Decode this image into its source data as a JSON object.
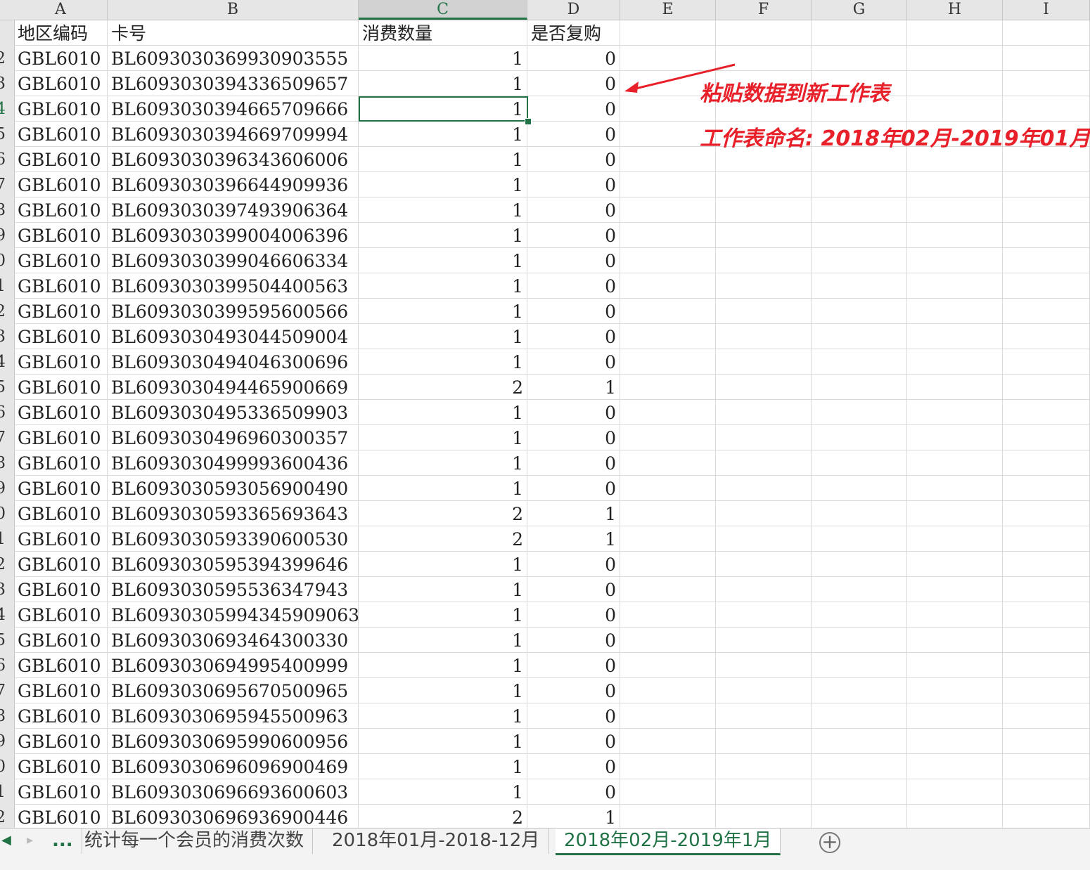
{
  "columns": [
    {
      "letter": "A"
    },
    {
      "letter": "B"
    },
    {
      "letter": "C"
    },
    {
      "letter": "D"
    },
    {
      "letter": "E"
    },
    {
      "letter": "F"
    },
    {
      "letter": "G"
    },
    {
      "letter": "H"
    },
    {
      "letter": "I"
    }
  ],
  "header_row": {
    "a": "地区编码",
    "b": "卡号",
    "c": "消费数量",
    "d": "是否复购"
  },
  "row_numbers": [
    "",
    "2",
    "3",
    "4",
    "5",
    "6",
    "7",
    "8",
    "9",
    "0",
    "1",
    "2",
    "3",
    "4",
    "5",
    "6",
    "7",
    "8",
    "9",
    "0",
    "1",
    "2",
    "3",
    "4",
    "5",
    "6",
    "7",
    "8",
    "9",
    "0",
    "1",
    "2"
  ],
  "rows": [
    {
      "a": "GBL6010",
      "b": "BL609303036993090355​5",
      "c": "1",
      "d": "0"
    },
    {
      "a": "GBL6010",
      "b": "BL6093030394336509657",
      "c": "1",
      "d": "0"
    },
    {
      "a": "GBL6010",
      "b": "BL6093030394665709666",
      "c": "1",
      "d": "0"
    },
    {
      "a": "GBL6010",
      "b": "BL6093030394669709994",
      "c": "1",
      "d": "0"
    },
    {
      "a": "GBL6010",
      "b": "BL6093030396343606006",
      "c": "1",
      "d": "0"
    },
    {
      "a": "GBL6010",
      "b": "BL6093030396644909936",
      "c": "1",
      "d": "0"
    },
    {
      "a": "GBL6010",
      "b": "BL6093030397493906364",
      "c": "1",
      "d": "0"
    },
    {
      "a": "GBL6010",
      "b": "BL6093030399004006396",
      "c": "1",
      "d": "0"
    },
    {
      "a": "GBL6010",
      "b": "BL6093030399046606334",
      "c": "1",
      "d": "0"
    },
    {
      "a": "GBL6010",
      "b": "BL6093030399504400563",
      "c": "1",
      "d": "0"
    },
    {
      "a": "GBL6010",
      "b": "BL6093030399595600566",
      "c": "1",
      "d": "0"
    },
    {
      "a": "GBL6010",
      "b": "BL6093030493044509004",
      "c": "1",
      "d": "0"
    },
    {
      "a": "GBL6010",
      "b": "BL6093030494046300696",
      "c": "1",
      "d": "0"
    },
    {
      "a": "GBL6010",
      "b": "BL6093030494465900669",
      "c": "2",
      "d": "1"
    },
    {
      "a": "GBL6010",
      "b": "BL6093030495336509903",
      "c": "1",
      "d": "0"
    },
    {
      "a": "GBL6010",
      "b": "BL6093030496960300357",
      "c": "1",
      "d": "0"
    },
    {
      "a": "GBL6010",
      "b": "BL6093030499993600436",
      "c": "1",
      "d": "0"
    },
    {
      "a": "GBL6010",
      "b": "BL6093030593056900490",
      "c": "1",
      "d": "0"
    },
    {
      "a": "GBL6010",
      "b": "BL6093030593365693643",
      "c": "2",
      "d": "1"
    },
    {
      "a": "GBL6010",
      "b": "BL6093030593390600530",
      "c": "2",
      "d": "1"
    },
    {
      "a": "GBL6010",
      "b": "BL6093030595394399646",
      "c": "1",
      "d": "0"
    },
    {
      "a": "GBL6010",
      "b": "BL6093030595536347943",
      "c": "1",
      "d": "0"
    },
    {
      "a": "GBL6010",
      "b": "BL60930305994345909063",
      "c": "1",
      "d": "0"
    },
    {
      "a": "GBL6010",
      "b": "BL6093030693464300330",
      "c": "1",
      "d": "0"
    },
    {
      "a": "GBL6010",
      "b": "BL6093030694995400999",
      "c": "1",
      "d": "0"
    },
    {
      "a": "GBL6010",
      "b": "BL6093030695670500965",
      "c": "1",
      "d": "0"
    },
    {
      "a": "GBL6010",
      "b": "BL6093030695945500963",
      "c": "1",
      "d": "0"
    },
    {
      "a": "GBL6010",
      "b": "BL6093030695990600956",
      "c": "1",
      "d": "0"
    },
    {
      "a": "GBL6010",
      "b": "BL6093030696096900469",
      "c": "1",
      "d": "0"
    },
    {
      "a": "GBL6010",
      "b": "BL6093030696693600603",
      "c": "1",
      "d": "0"
    },
    {
      "a": "GBL6010",
      "b": "BL6093030696936900446",
      "c": "2",
      "d": "1"
    }
  ],
  "annotation": {
    "line1": "粘贴数据到新工作表",
    "line2": "工作表命名: 2018年02月-2019年01月",
    "color": "#e8202a"
  },
  "sheet_tabs": {
    "more": "...",
    "tabs": [
      "统计每一个会员的消费次数",
      "2018年01月-2018-12月",
      "2018年02月-2019年1月"
    ],
    "active_index": 2,
    "add_icon": "plus-circle-icon"
  },
  "colors": {
    "accent": "#217346",
    "header_bg": "#e6e6e6",
    "grid": "#d9d9d9"
  }
}
